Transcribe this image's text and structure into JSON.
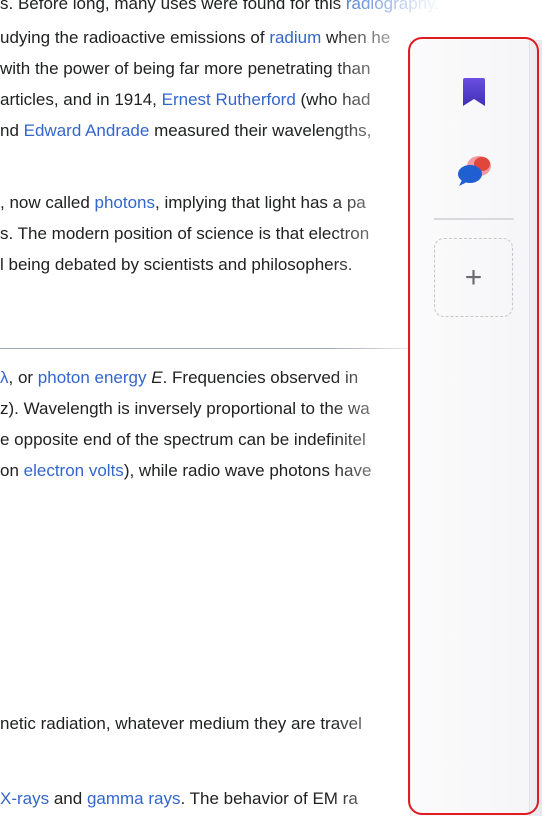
{
  "article": {
    "lines": [
      {
        "parts": [
          {
            "t": "s. Before long, many uses were found for this ",
            "k": "text"
          },
          {
            "t": "radiography",
            "k": "link"
          },
          {
            "t": ".",
            "k": "text"
          }
        ]
      },
      {
        "parts": [
          {
            "t": "udying the radioactive emissions of ",
            "k": "text"
          },
          {
            "t": "radium",
            "k": "link"
          },
          {
            "t": " when he",
            "k": "text"
          }
        ]
      },
      {
        "parts": [
          {
            "t": "with the power of being far more penetrating than",
            "k": "text"
          }
        ]
      },
      {
        "parts": [
          {
            "t": "articles, and in 1914, ",
            "k": "text"
          },
          {
            "t": "Ernest Rutherford",
            "k": "link"
          },
          {
            "t": " (who had",
            "k": "text"
          }
        ]
      },
      {
        "parts": [
          {
            "t": "nd ",
            "k": "text"
          },
          {
            "t": "Edward Andrade",
            "k": "link"
          },
          {
            "t": " measured their wavelengths,",
            "k": "text"
          }
        ]
      },
      {
        "parts": [
          {
            "t": ", now called ",
            "k": "text"
          },
          {
            "t": "photons",
            "k": "link"
          },
          {
            "t": ", implying that light has a pa",
            "k": "text"
          }
        ]
      },
      {
        "parts": [
          {
            "t": "s. The modern position of science is that electron",
            "k": "text"
          }
        ]
      },
      {
        "parts": [
          {
            "t": "l being debated by scientists and philosophers.",
            "k": "text"
          }
        ]
      },
      {
        "parts": [
          {
            "t": "λ",
            "k": "link"
          },
          {
            "t": ", or ",
            "k": "text"
          },
          {
            "t": "photon energy",
            "k": "link"
          },
          {
            "t": " ",
            "k": "text"
          },
          {
            "t": "E",
            "k": "ital"
          },
          {
            "t": ". Frequencies observed in",
            "k": "text"
          }
        ]
      },
      {
        "parts": [
          {
            "t": "z). Wavelength is inversely proportional to the wa",
            "k": "text"
          }
        ]
      },
      {
        "parts": [
          {
            "t": "e opposite end of the spectrum can be indefinitel",
            "k": "text"
          }
        ]
      },
      {
        "parts": [
          {
            "t": "on ",
            "k": "text"
          },
          {
            "t": "electron volts",
            "k": "link"
          },
          {
            "t": "), while radio wave photons have",
            "k": "text"
          }
        ]
      },
      {
        "parts": [
          {
            "t": "netic radiation, whatever medium they are travel",
            "k": "text"
          }
        ]
      },
      {
        "parts": [
          {
            "t": "X-rays",
            "k": "link"
          },
          {
            "t": " and ",
            "k": "text"
          },
          {
            "t": "gamma rays",
            "k": "link"
          },
          {
            "t": ". The behavior of EM ra",
            "k": "text"
          }
        ]
      }
    ]
  },
  "sidebar": {
    "buttons": [
      {
        "name": "bookmark-icon",
        "color": "#5b3fd6"
      },
      {
        "name": "copilot-chat-icon",
        "colors": [
          "#1f5fd1",
          "#e0463b",
          "#f29aa3"
        ]
      }
    ],
    "add_label": "+"
  },
  "colors": {
    "link": "#3366cc",
    "text": "#202122",
    "highlight": "#e01b24"
  }
}
